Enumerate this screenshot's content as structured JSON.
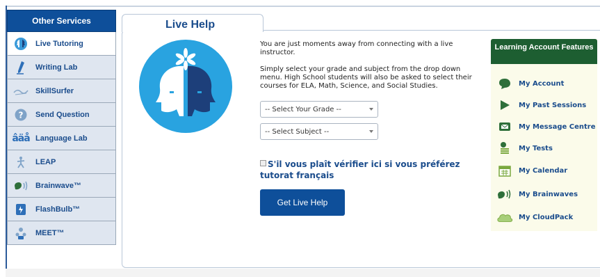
{
  "sidebar": {
    "header": "Other Services",
    "items": [
      {
        "label": "Live Tutoring",
        "icon": "faces-icon"
      },
      {
        "label": "Writing Lab",
        "icon": "pen-icon"
      },
      {
        "label": "SkillSurfer",
        "icon": "wave-icon"
      },
      {
        "label": "Send Question",
        "icon": "question-icon"
      },
      {
        "label": "Language Lab",
        "icon": "letters-icon"
      },
      {
        "label": "LEAP",
        "icon": "leap-icon"
      },
      {
        "label": "Brainwave™",
        "icon": "brainwave-icon"
      },
      {
        "label": "FlashBulb™",
        "icon": "flashbulb-icon"
      },
      {
        "label": "MEET™",
        "icon": "meet-icon"
      }
    ]
  },
  "main": {
    "tab_title": "Live Help",
    "intro": "You are just moments away from connecting with a live instructor.",
    "instructions": "Simply select your grade and subject from the drop down menu. High School students will also be asked to select their courses for ELA, Math, Science, and Social Studies.",
    "grade_select": "-- Select Your Grade --",
    "subject_select": "-- Select Subject --",
    "french_option": "S'il vous plaît vérifier ici si vous préférez tutorat français",
    "button_label": "Get Live Help"
  },
  "features": {
    "header": "Learning Account Features",
    "items": [
      {
        "label": "My Account",
        "icon": "chat-bubble-icon"
      },
      {
        "label": "My Past Sessions",
        "icon": "play-icon"
      },
      {
        "label": "My Message Centre",
        "icon": "envelope-icon"
      },
      {
        "label": "My Tests",
        "icon": "tests-icon"
      },
      {
        "label": "My Calendar",
        "icon": "calendar-icon"
      },
      {
        "label": "My Brainwaves",
        "icon": "brainwave-icon"
      },
      {
        "label": "My CloudPack",
        "icon": "cloud-icon"
      }
    ]
  },
  "colors": {
    "brand_blue": "#0e4f9a",
    "feature_green": "#1d5e31",
    "link_blue": "#1a4c8c"
  }
}
